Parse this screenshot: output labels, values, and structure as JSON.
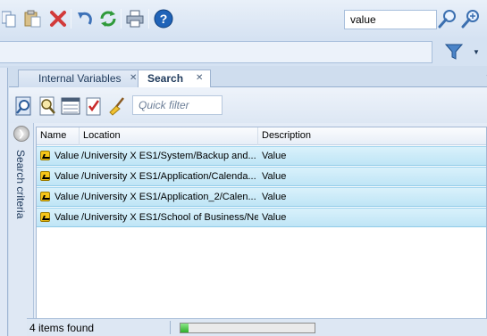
{
  "toolbar": {
    "buttons": [
      {
        "name": "copy-icon",
        "color": "#6c8cb5"
      },
      {
        "name": "paste-icon",
        "color": "#b99c59"
      },
      {
        "name": "delete-icon",
        "color": "#d23a3a"
      },
      {
        "name": "undo-icon",
        "color": "#3e72b8"
      },
      {
        "name": "refresh-icon",
        "color": "#2f9a3a"
      },
      {
        "name": "print-icon",
        "color": "#53667f"
      },
      {
        "name": "help-icon",
        "color": "#1f63b8"
      }
    ],
    "search_value": "value"
  },
  "tabs": [
    {
      "label": "Internal Variables",
      "active": false
    },
    {
      "label": "Search",
      "active": true
    }
  ],
  "search_panel": {
    "quick_filter_placeholder": "Quick filter",
    "criteria_label": "Search criteria",
    "columns": [
      "Name",
      "Location",
      "Description"
    ],
    "rows": [
      {
        "name": "Value",
        "location": "/University X ES1/System/Backup and...",
        "description": "Value"
      },
      {
        "name": "Value",
        "location": "/University X ES1/Application/Calenda...",
        "description": "Value"
      },
      {
        "name": "Value",
        "location": "/University X ES1/Application_2/Calen...",
        "description": "Value"
      },
      {
        "name": "Value",
        "location": "/University X ES1/School of Business/Ne",
        "description": "Value"
      }
    ],
    "status": "4 items found",
    "progress": 0.06
  },
  "colors": {
    "selection": "#bfe5f6",
    "progress_green": "#2fae2b"
  }
}
